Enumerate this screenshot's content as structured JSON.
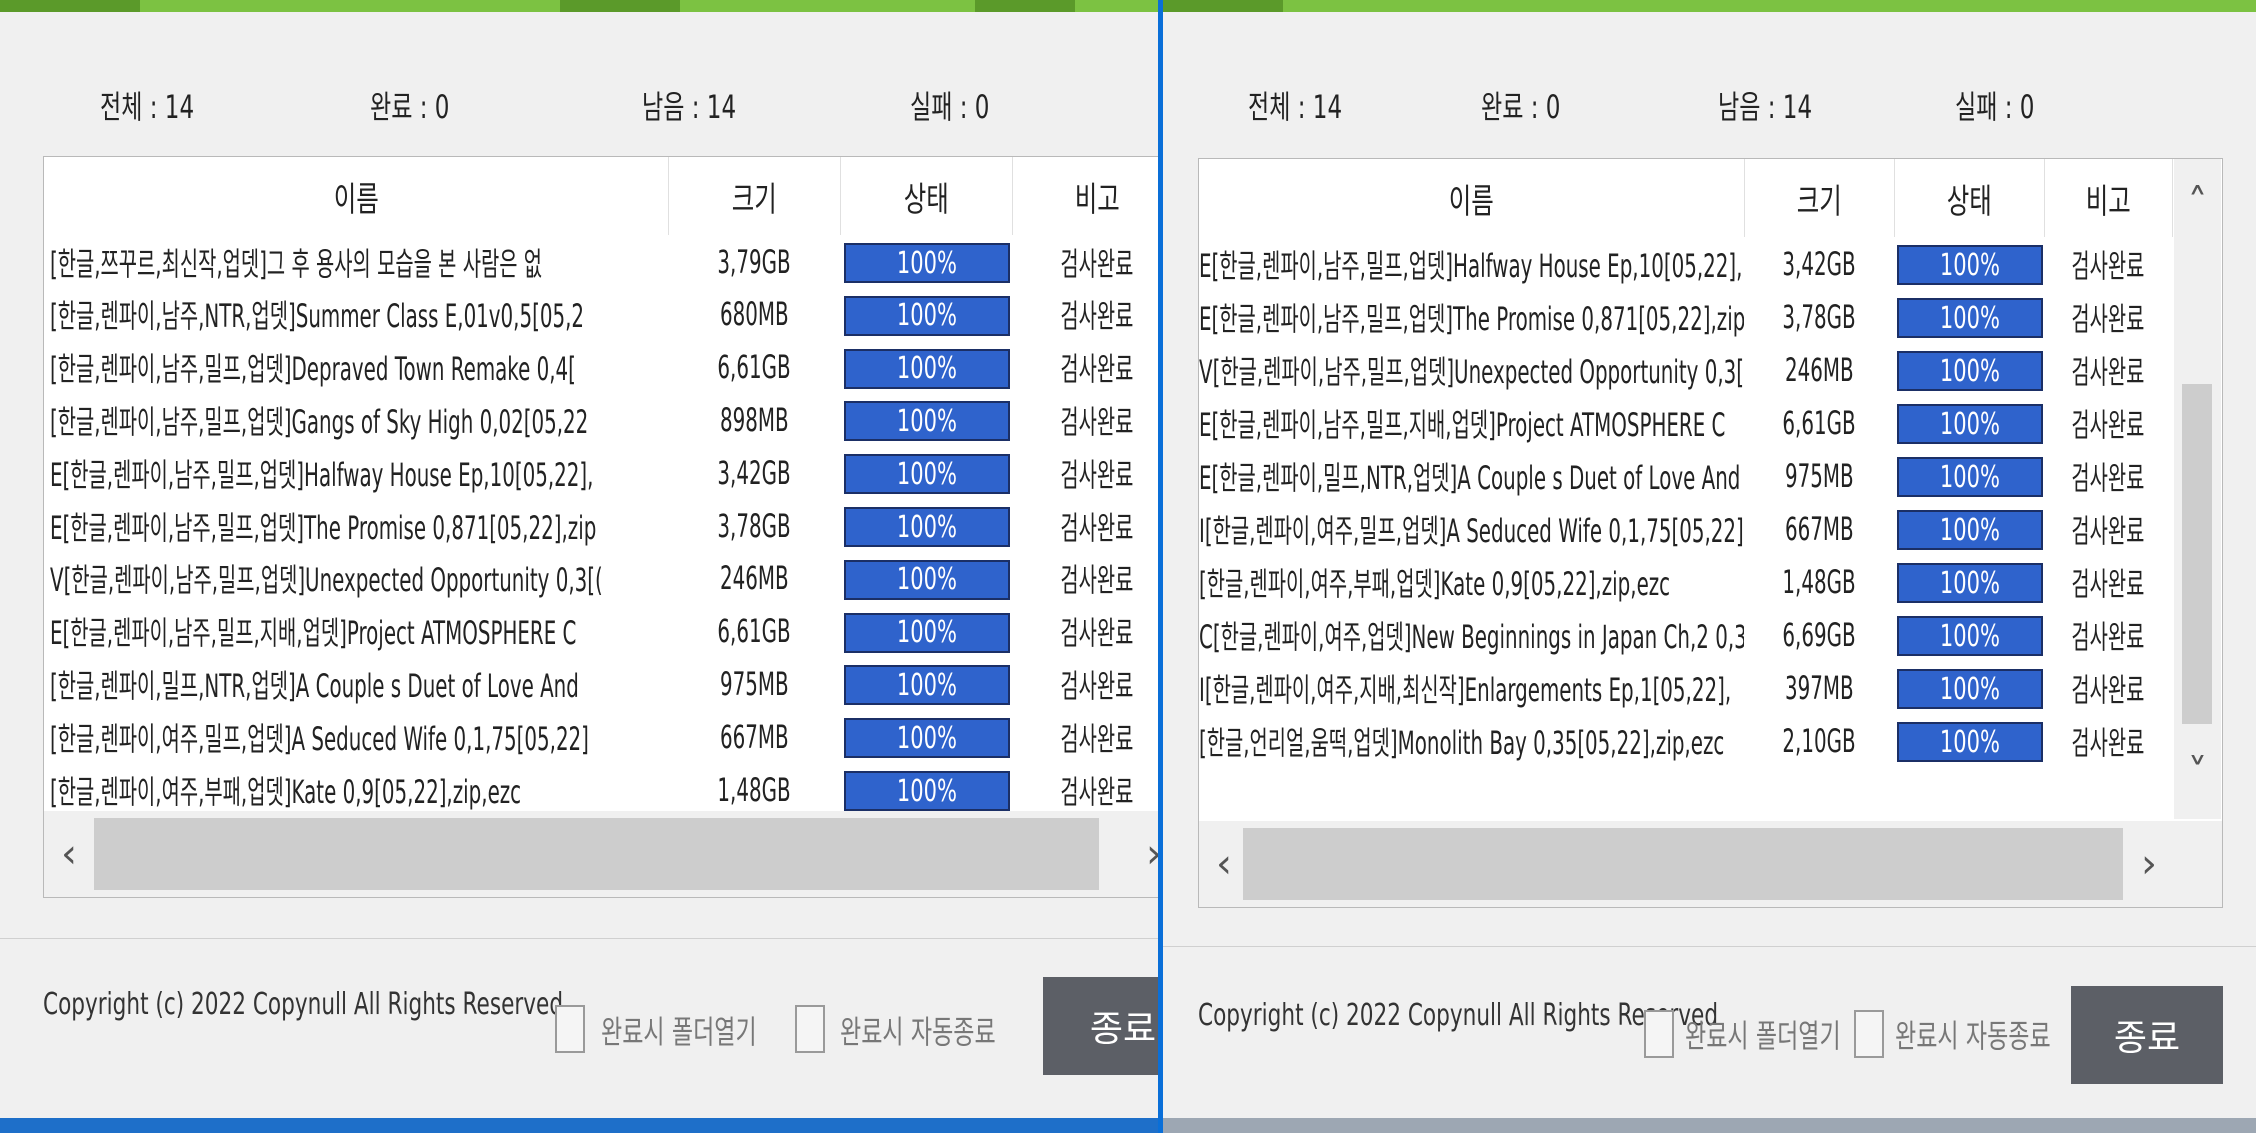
{
  "left": {
    "stats": {
      "total": "전체 : 14",
      "done": "완료 : 0",
      "remaining": "남음 : 14",
      "failed": "실패 : 0"
    },
    "columns": [
      "이름",
      "크기",
      "상태",
      "비고"
    ],
    "rows": [
      {
        "name": "[한글,쯔꾸르,최신작,업뎃]그 후 용사의 모습을 본 사람은 없",
        "size": "3,79GB",
        "progress": 100,
        "status": "100%",
        "note": "검사완료"
      },
      {
        "name": "[한글,렌파이,남주,NTR,업뎃]Summer Class E,01v0,5[05,2",
        "size": "680MB",
        "progress": 100,
        "status": "100%",
        "note": "검사완료"
      },
      {
        "name": "[한글,렌파이,남주,밀프,업뎃]Depraved Town Remake 0,4[",
        "size": "6,61GB",
        "progress": 100,
        "status": "100%",
        "note": "검사완료"
      },
      {
        "name": "[한글,렌파이,남주,밀프,업뎃]Gangs of Sky High 0,02[05,22",
        "size": "898MB",
        "progress": 100,
        "status": "100%",
        "note": "검사완료"
      },
      {
        "name": "E[한글,렌파이,남주,밀프,업뎃]Halfway House Ep,10[05,22],",
        "size": "3,42GB",
        "progress": 100,
        "status": "100%",
        "note": "검사완료"
      },
      {
        "name": "E[한글,렌파이,남주,밀프,업뎃]The Promise 0,871[05,22],zip",
        "size": "3,78GB",
        "progress": 100,
        "status": "100%",
        "note": "검사완료"
      },
      {
        "name": "V[한글,렌파이,남주,밀프,업뎃]Unexpected Opportunity 0,3[(",
        "size": "246MB",
        "progress": 100,
        "status": "100%",
        "note": "검사완료"
      },
      {
        "name": "E[한글,렌파이,남주,밀프,지배,업뎃]Project ATMOSPHERE C",
        "size": "6,61GB",
        "progress": 100,
        "status": "100%",
        "note": "검사완료"
      },
      {
        "name": "[한글,렌파이,밀프,NTR,업뎃]A Couple s Duet of Love And",
        "size": "975MB",
        "progress": 100,
        "status": "100%",
        "note": "검사완료"
      },
      {
        "name": "[한글,렌파이,여주,밀프,업뎃]A Seduced Wife 0,1,75[05,22]",
        "size": "667MB",
        "progress": 100,
        "status": "100%",
        "note": "검사완료"
      },
      {
        "name": "[한글,렌파이,여주,부패,업뎃]Kate 0,9[05,22],zip,ezc",
        "size": "1,48GB",
        "progress": 100,
        "status": "100%",
        "note": "검사완료"
      }
    ],
    "copyright": "Copyright (c) 2022 Copynull All Rights Reserved",
    "open_folder_label": "완료시 폴더열기",
    "auto_exit_label": "완료시 자동종료",
    "close_button": "종료"
  },
  "right": {
    "stats": {
      "total": "전체 : 14",
      "done": "완료 : 0",
      "remaining": "남음 : 14",
      "failed": "실패 : 0"
    },
    "columns": [
      "이름",
      "크기",
      "상태",
      "비고"
    ],
    "rows": [
      {
        "name": "E[한글,렌파이,남주,밀프,업뎃]Halfway House Ep,10[05,22],",
        "size": "3,42GB",
        "progress": 100,
        "status": "100%",
        "note": "검사완료"
      },
      {
        "name": "E[한글,렌파이,남주,밀프,업뎃]The Promise 0,871[05,22],zip",
        "size": "3,78GB",
        "progress": 100,
        "status": "100%",
        "note": "검사완료"
      },
      {
        "name": "V[한글,렌파이,남주,밀프,업뎃]Unexpected Opportunity 0,3[(",
        "size": "246MB",
        "progress": 100,
        "status": "100%",
        "note": "검사완료"
      },
      {
        "name": "E[한글,렌파이,남주,밀프,지배,업뎃]Project ATMOSPHERE C",
        "size": "6,61GB",
        "progress": 100,
        "status": "100%",
        "note": "검사완료"
      },
      {
        "name": "E[한글,렌파이,밀프,NTR,업뎃]A Couple s Duet of Love And",
        "size": "975MB",
        "progress": 100,
        "status": "100%",
        "note": "검사완료"
      },
      {
        "name": "I[한글,렌파이,여주,밀프,업뎃]A Seduced Wife 0,1,75[05,22]",
        "size": "667MB",
        "progress": 100,
        "status": "100%",
        "note": "검사완료"
      },
      {
        "name": "[한글,렌파이,여주,부패,업뎃]Kate 0,9[05,22],zip,ezc",
        "size": "1,48GB",
        "progress": 100,
        "status": "100%",
        "note": "검사완료"
      },
      {
        "name": "C[한글,렌파이,여주,업뎃]New Beginnings in Japan Ch,2 0,3",
        "size": "6,69GB",
        "progress": 100,
        "status": "100%",
        "note": "검사완료"
      },
      {
        "name": "I[한글,렌파이,여주,지배,최신작]Enlargements Ep,1[05,22],",
        "size": "397MB",
        "progress": 100,
        "status": "100%",
        "note": "검사완료"
      },
      {
        "name": "[한글,언리얼,움떡,업뎃]Monolith Bay 0,35[05,22],zip,ezc",
        "size": "2,10GB",
        "progress": 100,
        "status": "100%",
        "note": "검사완료"
      }
    ],
    "copyright": "Copyright (c) 2022 Copynull All Rights Reserved",
    "open_folder_label": "완료시 폴더열기",
    "auto_exit_label": "완료시 자동종료",
    "close_button": "종료"
  },
  "icons": {
    "scroll_left": "chevron-left-icon",
    "scroll_right": "chevron-right-icon",
    "scroll_up": "chevron-up-icon",
    "scroll_down": "chevron-down-icon"
  },
  "colors": {
    "progress_fill": "#2f63cc",
    "title_accent": "#7cc242",
    "close_button": "#5c5f66",
    "divider": "#0a6fd8"
  }
}
